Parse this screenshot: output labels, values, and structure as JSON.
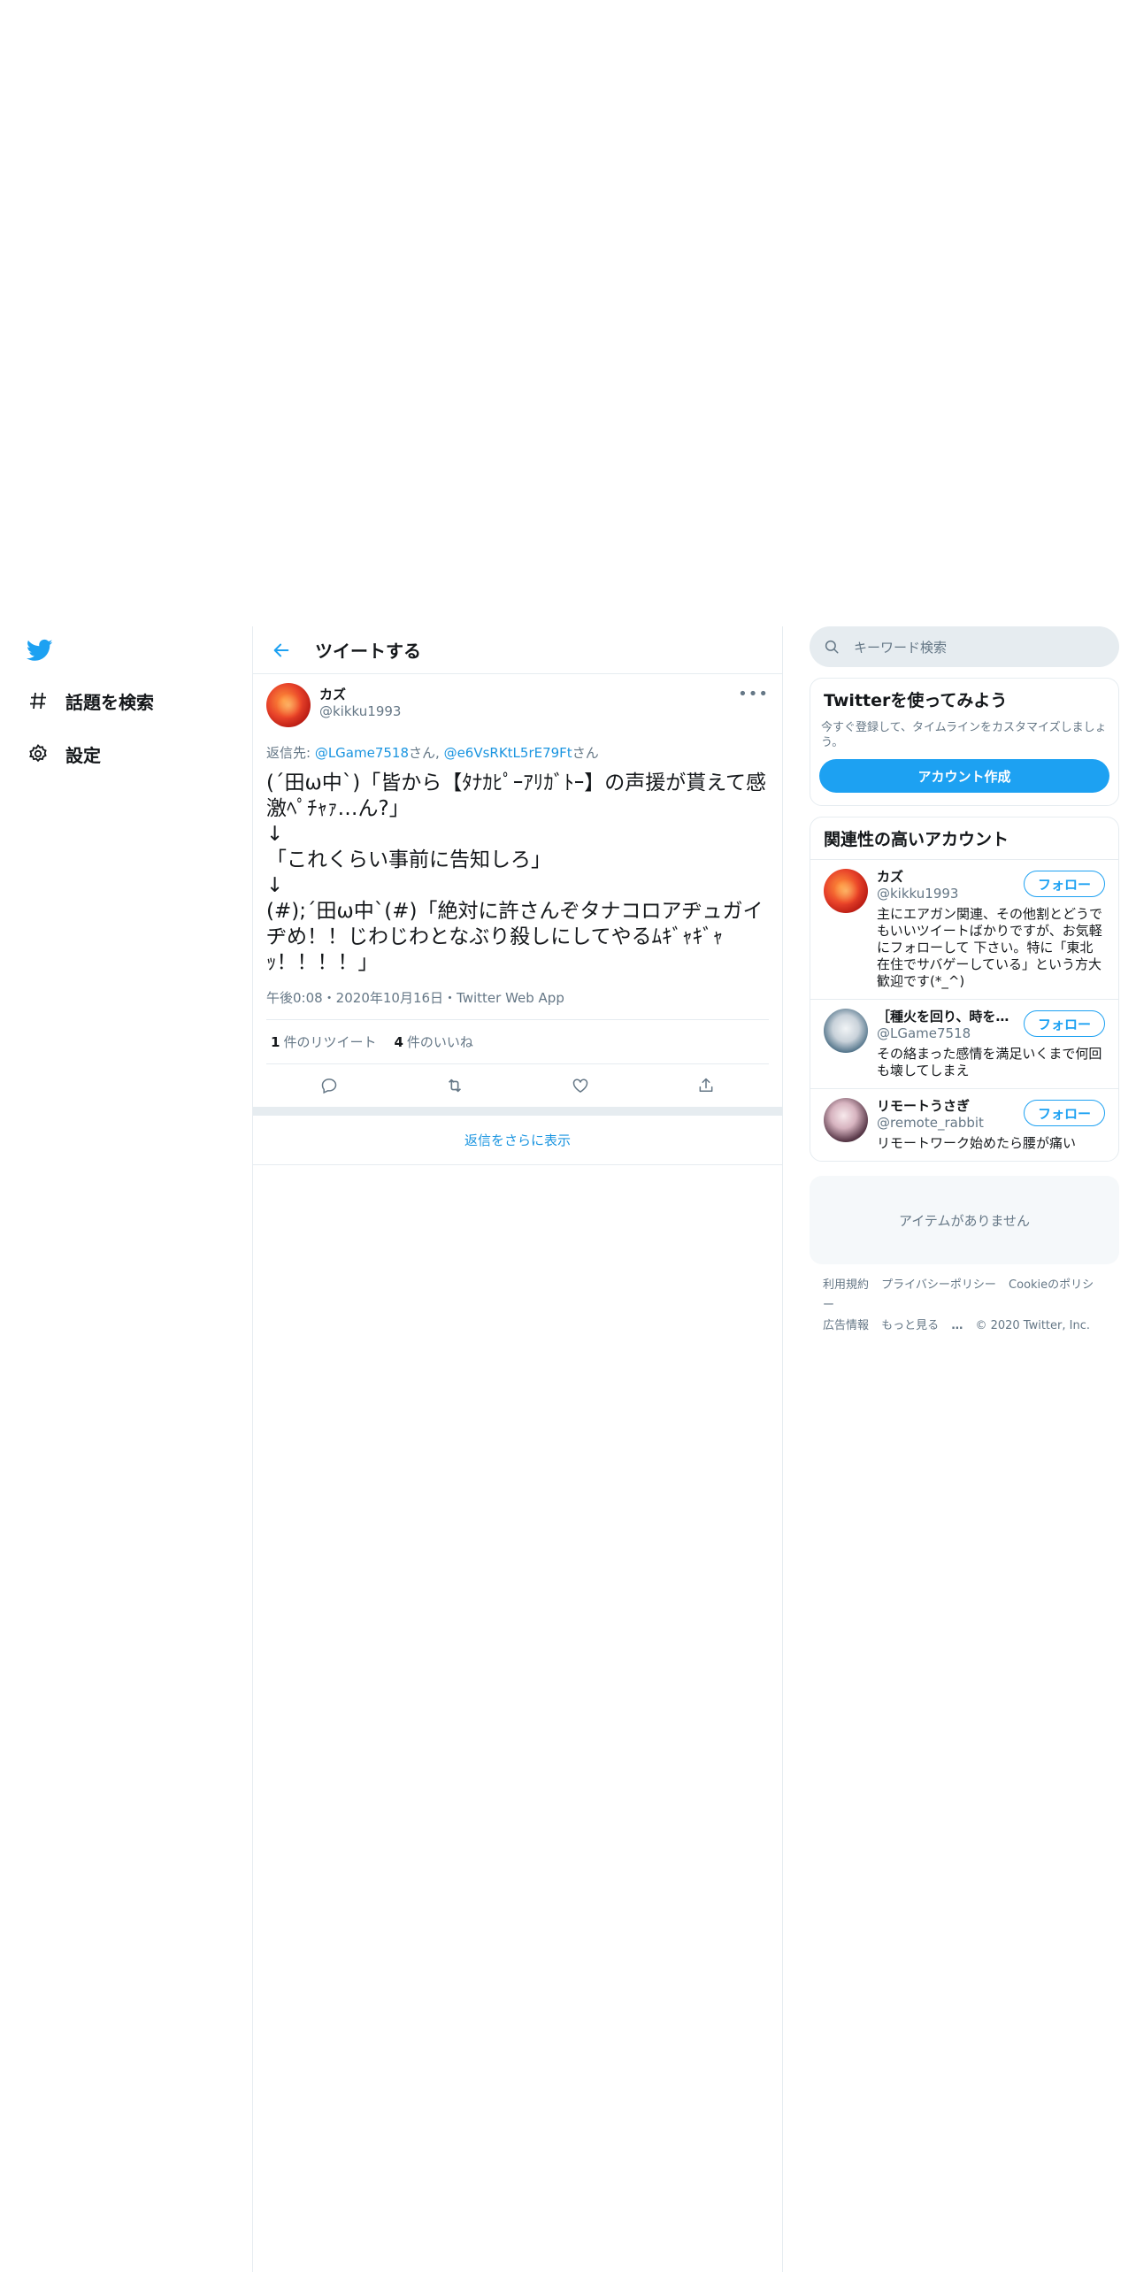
{
  "nav": {
    "items": [
      {
        "label": "話題を検索"
      },
      {
        "label": "設定"
      }
    ]
  },
  "header": {
    "title": "ツイートする"
  },
  "tweet": {
    "name": "カズ",
    "handle": "@kikku1993",
    "more": "•••",
    "reply_prefix": "返信先: ",
    "reply_user1": "@LGame7518",
    "reply_suffix1": "さん, ",
    "reply_user2": "@e6VsRKtL5rE79Ft",
    "reply_suffix2": "さん",
    "text": "(´田ω中`)「皆から【ﾀﾅｶﾋﾟｰｱﾘｶﾞﾄｰ】の声援が貰えて感激ﾍﾟﾁｬｧ…ん?」\n↓\n「これくらい事前に告知しろ」\n↓\n(#);´田ω中`(#)「絶対に許さんぞタナコロアヂュガイヂめ！！じわじわとなぶり殺しにしてやるﾑｷﾞｬｷﾞｬｯ！！！！」",
    "meta": "午後0:08・2020年10月16日・Twitter Web App",
    "retweet_count": "1",
    "retweet_label": "件のリツイート",
    "like_count": "4",
    "like_label": "件のいいね"
  },
  "show_more": "返信をさらに表示",
  "search": {
    "placeholder": "キーワード検索"
  },
  "signup": {
    "title": "Twitterを使ってみよう",
    "text": "今すぐ登録して、タイムラインをカスタマイズしましょう。",
    "button": "アカウント作成"
  },
  "related": {
    "title": "関連性の高いアカウント",
    "follow_label": "フォロー",
    "accounts": [
      {
        "name": "カズ",
        "handle": "@kikku1993",
        "bio": "主にエアガン関連、その他割とどうでもいいツイートばかりですが、お気軽にフォローして 下さい。特に「東北在住でサバゲーしている」という方大歓迎です(*_^)"
      },
      {
        "name": "［種火を回り、時を…",
        "handle": "@LGame7518",
        "bio": "その絡まった感情を満足いくまで何回も壊してしまえ"
      },
      {
        "name": "リモートうさぎ",
        "handle": "@remote_rabbit",
        "bio": "リモートワーク始めたら腰が痛い"
      }
    ]
  },
  "empty": "アイテムがありません",
  "footer": {
    "terms": "利用規約",
    "privacy": "プライバシーポリシー",
    "cookie": "Cookieのポリシー",
    "ads": "広告情報",
    "more": "もっと見る",
    "more_dots": "…",
    "copyright": "© 2020 Twitter, Inc."
  },
  "colors": {
    "accent": "#1da1f2",
    "link": "#1b95e0",
    "muted": "#657786",
    "border": "#e6ecf0"
  }
}
